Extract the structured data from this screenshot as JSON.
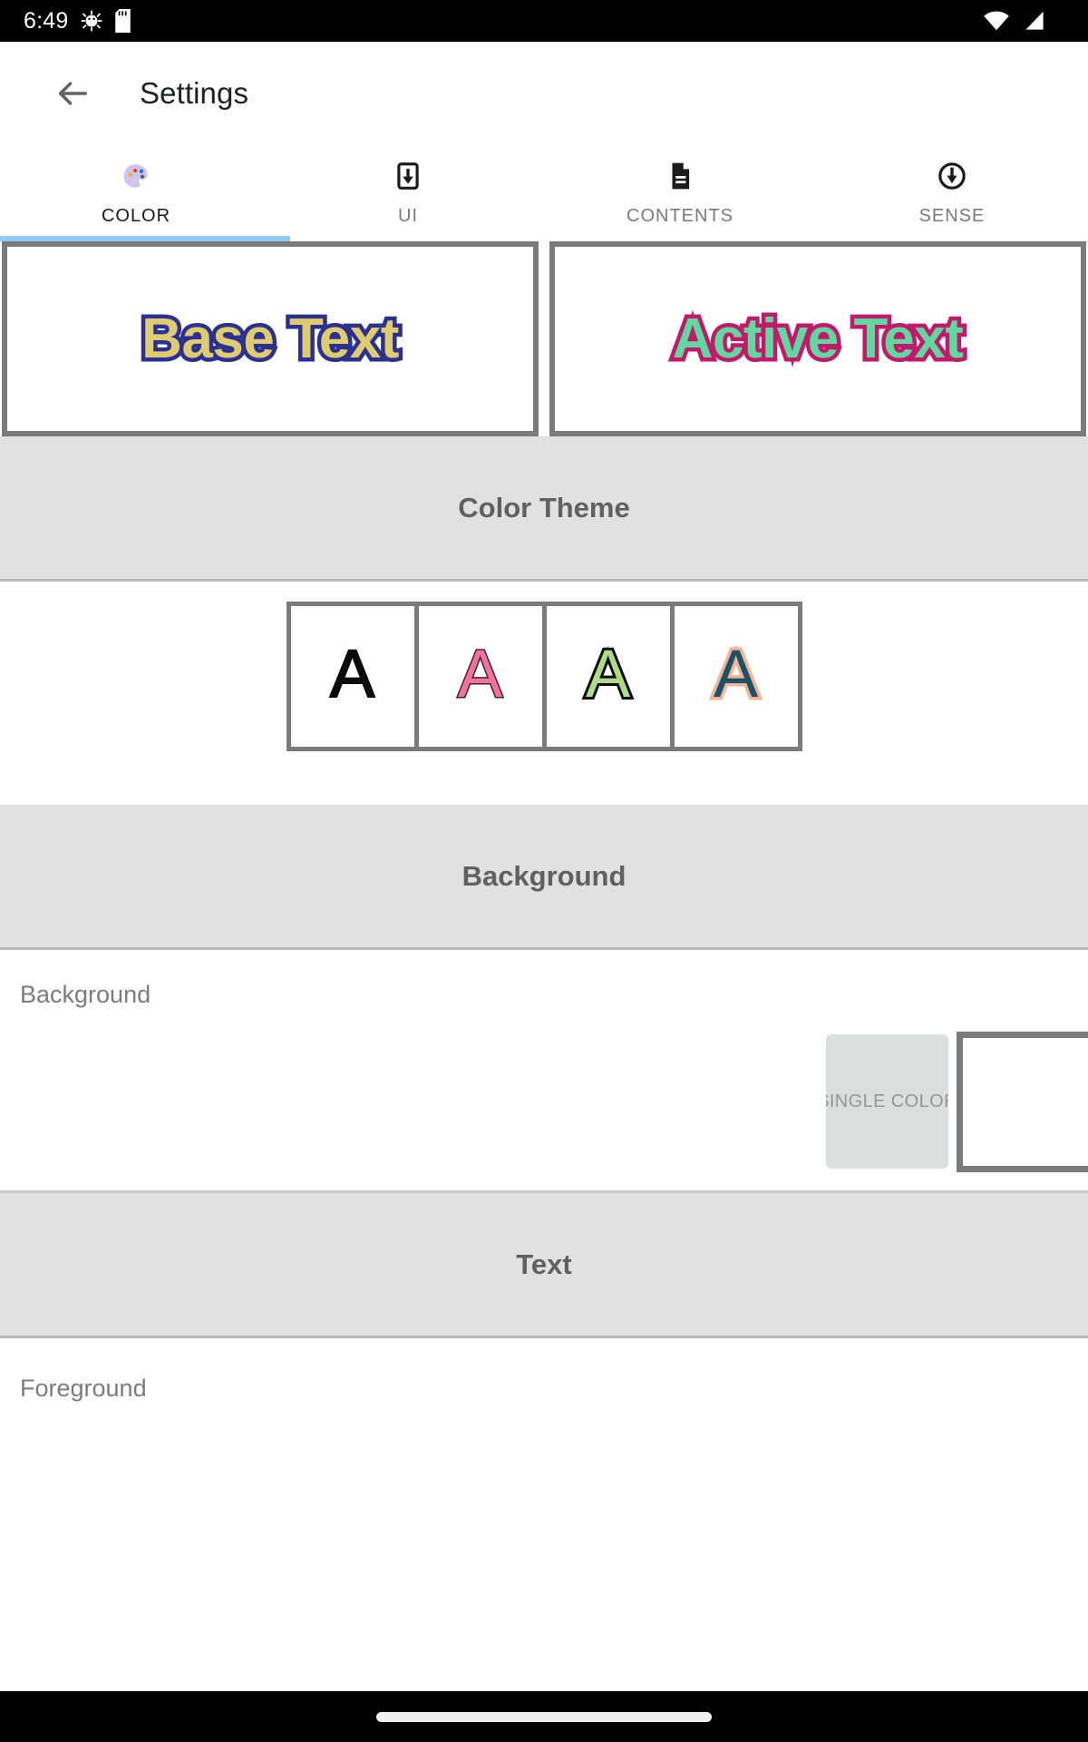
{
  "status_bar": {
    "clock": "6:49",
    "left_icons": [
      "android-debug-icon",
      "sd-card-icon"
    ],
    "right_icons": [
      "wifi-icon",
      "cellular-signal-icon"
    ]
  },
  "app_bar": {
    "back_icon": "back-arrow-icon",
    "title": "Settings"
  },
  "tabs": [
    {
      "label": "COLOR",
      "icon": "palette-icon",
      "active": true
    },
    {
      "label": "UI",
      "icon": "download-box-icon",
      "active": false
    },
    {
      "label": "CONTENTS",
      "icon": "document-icon",
      "active": false
    },
    {
      "label": "SENSE",
      "icon": "circle-download-icon",
      "active": false
    }
  ],
  "tab_indicator_color": "#90CAF9",
  "preview": {
    "base": {
      "label": "Base Text",
      "fill_color": "#E0CC6E",
      "outline_color": "#2B3192"
    },
    "active": {
      "label": "Active Text",
      "fill_color": "#5FD9A0",
      "outline_color": "#C4186B"
    }
  },
  "sections": [
    {
      "title": "Color Theme"
    },
    {
      "title": "Background"
    },
    {
      "title": "Text"
    }
  ],
  "color_theme": {
    "section_title": "Color Theme",
    "swatches": [
      {
        "letter": "A",
        "fill_color": "#0B0B0B",
        "outline_color": "#0B0B0B",
        "selected": false
      },
      {
        "letter": "A",
        "fill_color": "#F7709A",
        "outline_color": "#3A2530",
        "selected": false
      },
      {
        "letter": "A",
        "fill_color": "#AEDB84",
        "outline_color": "#0B0B0B",
        "selected": false
      },
      {
        "letter": "A",
        "fill_color": "#195367",
        "outline_color": "#F7B194",
        "selected": false
      }
    ]
  },
  "background_section": {
    "section_title": "Background",
    "row_label": "Background",
    "mode_button_label": "SINGLE COLOR",
    "swatch_color": "#FFFFFF"
  },
  "text_section": {
    "section_title": "Text",
    "row_label": "Foreground"
  },
  "nav_bar": {
    "gesture_pill": "home-gesture-pill"
  }
}
